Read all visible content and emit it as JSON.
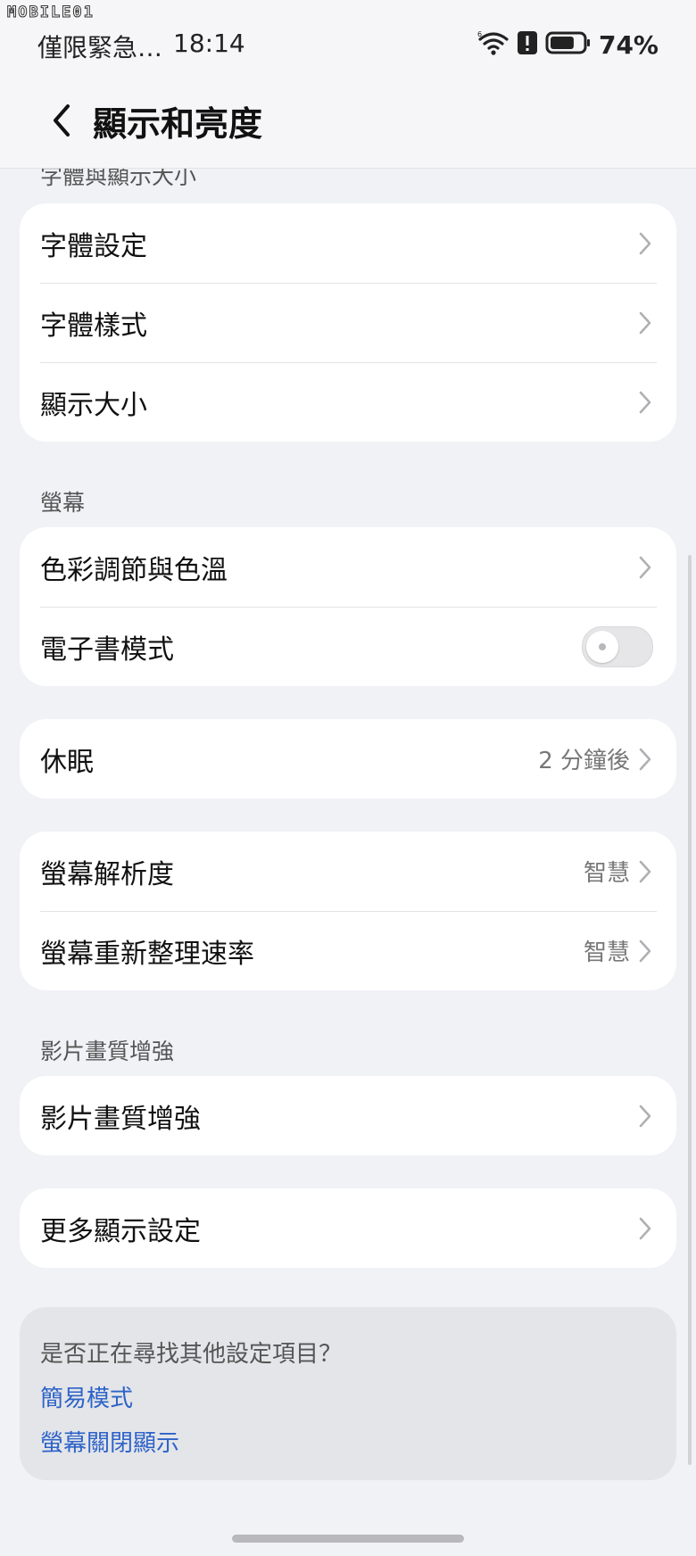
{
  "watermark": "MOBILE01",
  "status": {
    "carrier": "僅限緊急…",
    "time": "18:14",
    "battery": "74%",
    "battery_level": 0.74,
    "icons": [
      "wifi-icon",
      "alert-icon",
      "battery-icon"
    ]
  },
  "header": {
    "title": "顯示和亮度"
  },
  "sections": {
    "font_label": "字體與顯示大小",
    "screen_label": "螢幕",
    "video_label": "影片畫質增強"
  },
  "font_card": {
    "items": [
      {
        "label": "字體設定"
      },
      {
        "label": "字體樣式"
      },
      {
        "label": "顯示大小"
      }
    ]
  },
  "screen_card": {
    "color_label": "色彩調節與色溫",
    "ebook_label": "電子書模式",
    "ebook_enabled": false
  },
  "sleep": {
    "label": "休眠",
    "value": "2 分鐘後"
  },
  "resolution_card": {
    "resolution_label": "螢幕解析度",
    "resolution_value": "智慧",
    "refresh_label": "螢幕重新整理速率",
    "refresh_value": "智慧"
  },
  "video": {
    "label": "影片畫質增強"
  },
  "more": {
    "label": "更多顯示設定"
  },
  "suggest": {
    "question": "是否正在尋找其他設定項目？",
    "links": [
      "簡易模式",
      "螢幕關閉顯示"
    ]
  },
  "colors": {
    "background": "#f1f2f6",
    "card": "#ffffff",
    "link": "#2d63c8",
    "secondary_text": "#777777"
  }
}
